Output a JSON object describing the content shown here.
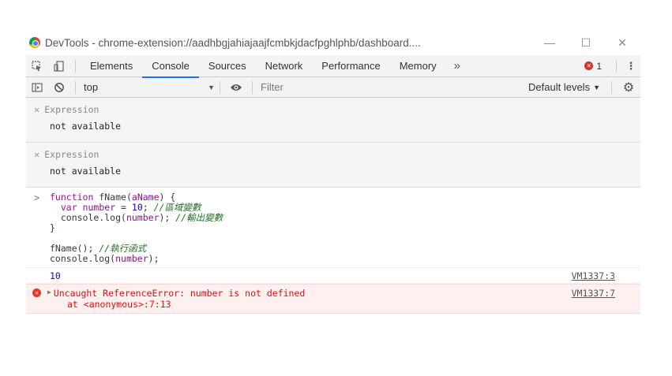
{
  "window": {
    "title": "DevTools - chrome-extension://aadhbgjahiajaajfcmbkjdacfpghlphb/dashboard....",
    "controls": {
      "minimize": "—",
      "maximize": "☐",
      "close": "✕"
    }
  },
  "tabs": [
    "Elements",
    "Console",
    "Sources",
    "Network",
    "Performance",
    "Memory"
  ],
  "active_tab": "Console",
  "tab_overflow": "»",
  "error_count": "1",
  "toolbar": {
    "context": "top",
    "filter_placeholder": "Filter",
    "levels": "Default levels"
  },
  "expressions": [
    {
      "label": "Expression",
      "value": "not available"
    },
    {
      "label": "Expression",
      "value": "not available"
    }
  ],
  "code": {
    "line1_kw": "function",
    "line1_name": "fName",
    "line1_param": "aName",
    "line2_kw": "var",
    "line2_var": "number",
    "line2_num": "10",
    "line2_comment": "//區域變數",
    "line3_pre": "console.log(",
    "line3_var": "number",
    "line3_comment": "//輸出變數",
    "line4": "}",
    "line6_call": "fName();",
    "line6_comment": "//執行函式",
    "line7_pre": "console.log(",
    "line7_var": "number",
    "line7_post": ");"
  },
  "log": {
    "value": "10",
    "source": "VM1337:3"
  },
  "error": {
    "message": "Uncaught ReferenceError: number is not defined",
    "stack": "at <anonymous>:7:13",
    "source": "VM1337:7"
  },
  "colors": {
    "accent": "#1a73e8",
    "error": "#d93025"
  }
}
